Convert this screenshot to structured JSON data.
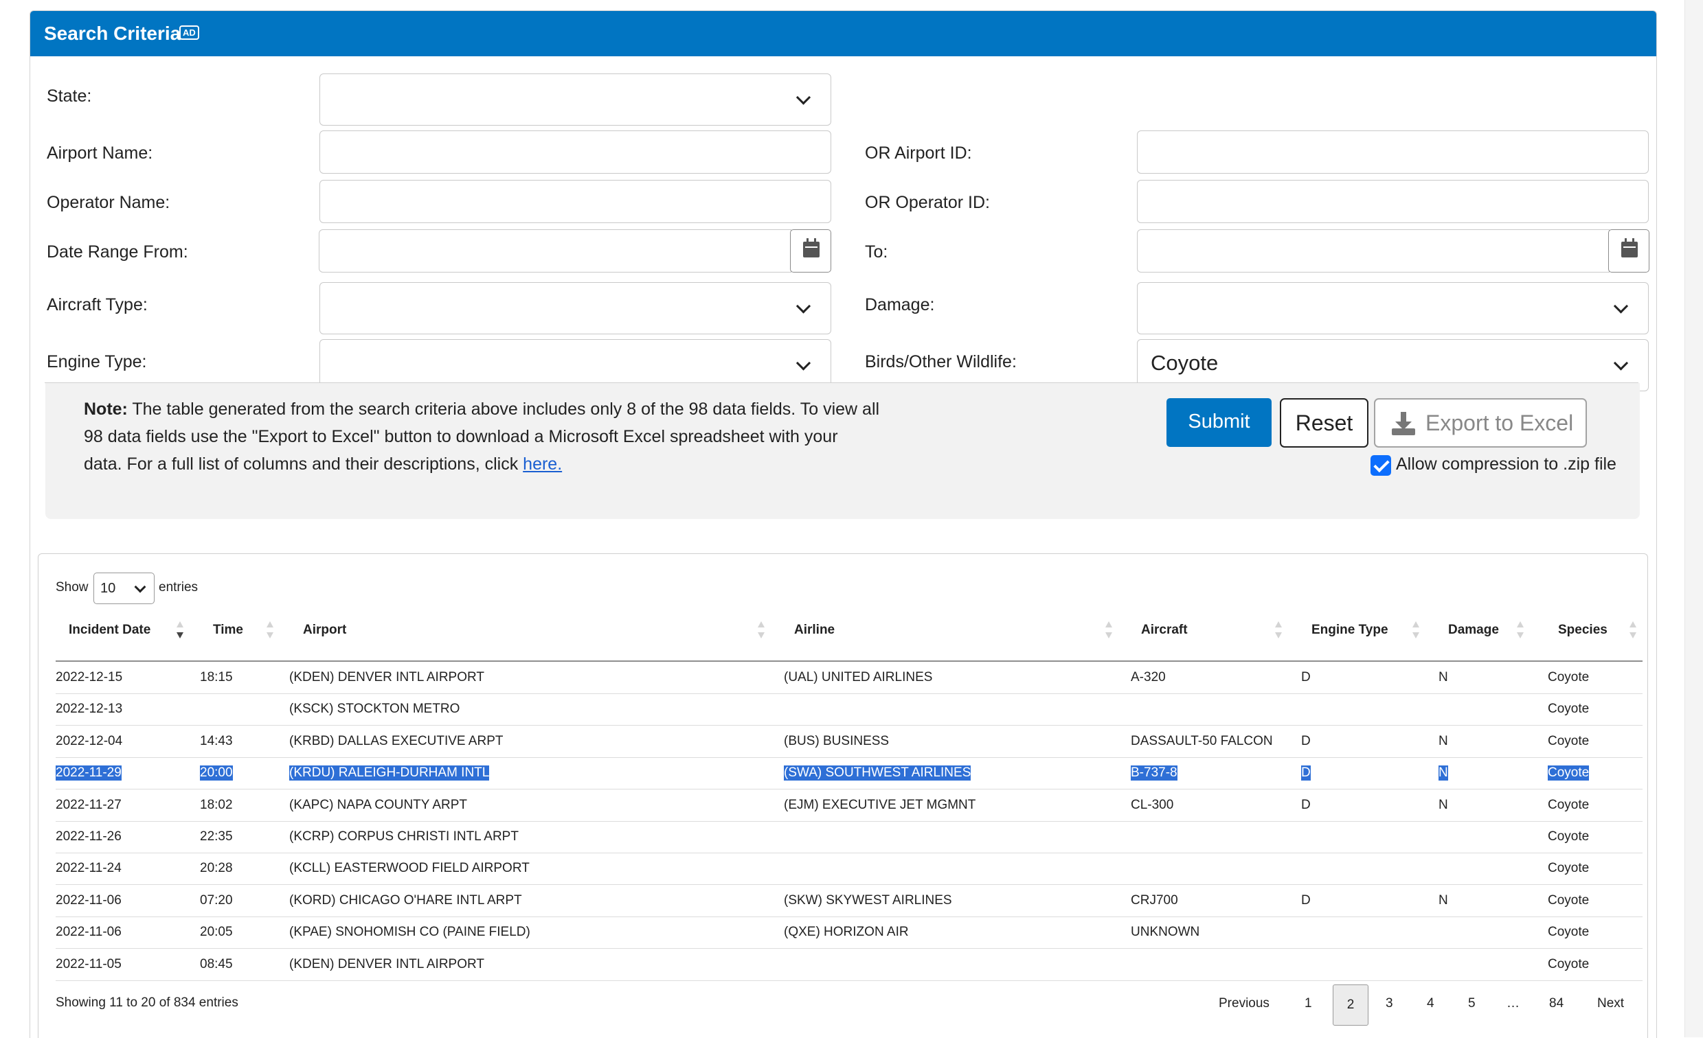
{
  "search": {
    "title": "Search Criteria",
    "badge": "AD",
    "labels": {
      "state": "State:",
      "airport_name": "Airport Name:",
      "airport_id": "OR Airport ID:",
      "operator_name": "Operator Name:",
      "operator_id": "OR Operator ID:",
      "date_from": "Date Range From:",
      "date_to": "To:",
      "aircraft_type": "Aircraft Type:",
      "damage": "Damage:",
      "engine_type": "Engine Type:",
      "wildlife": "Birds/Other Wildlife:"
    },
    "values": {
      "state": "",
      "airport_name": "",
      "airport_id": "",
      "operator_name": "",
      "operator_id": "",
      "date_from": "",
      "date_to": "",
      "aircraft_type": "",
      "damage": "",
      "engine_type": "",
      "wildlife": "Coyote"
    }
  },
  "note": {
    "bold": "Note:",
    "text": " The table generated from the search criteria above includes only 8 of the 98 data fields. To view all 98 data fields use the \"Export to Excel\" button to download a Microsoft Excel spreadsheet with your data. For a full list of columns and their descriptions, click ",
    "link": "here."
  },
  "buttons": {
    "submit": "Submit",
    "reset": "Reset",
    "export": "Export to Excel",
    "compress_label": "Allow compression to .zip file",
    "compress_checked": true
  },
  "table": {
    "show_label": "Show",
    "page_length": "10",
    "entries_label": "entries",
    "columns": [
      "Incident Date",
      "Time",
      "Airport",
      "Airline",
      "Aircraft",
      "Engine Type",
      "Damage",
      "Species"
    ],
    "rows": [
      [
        "2022-12-15",
        "18:15",
        "(KDEN) DENVER INTL AIRPORT",
        "(UAL) UNITED AIRLINES",
        "A-320",
        "D",
        "N",
        "Coyote"
      ],
      [
        "2022-12-13",
        "",
        "(KSCK) STOCKTON METRO",
        "",
        "",
        "",
        "",
        "Coyote"
      ],
      [
        "2022-12-04",
        "14:43",
        "(KRBD) DALLAS EXECUTIVE ARPT",
        "(BUS) BUSINESS",
        "DASSAULT-50 FALCON",
        "D",
        "N",
        "Coyote"
      ],
      [
        "2022-11-29",
        "20:00",
        "(KRDU) RALEIGH-DURHAM INTL",
        "(SWA) SOUTHWEST AIRLINES",
        "B-737-8",
        "D",
        "N",
        "Coyote"
      ],
      [
        "2022-11-27",
        "18:02",
        "(KAPC) NAPA COUNTY ARPT",
        "(EJM) EXECUTIVE JET MGMNT",
        "CL-300",
        "D",
        "N",
        "Coyote"
      ],
      [
        "2022-11-26",
        "22:35",
        "(KCRP) CORPUS CHRISTI INTL ARPT",
        "",
        "",
        "",
        "",
        "Coyote"
      ],
      [
        "2022-11-24",
        "20:28",
        "(KCLL) EASTERWOOD FIELD AIRPORT",
        "",
        "",
        "",
        "",
        "Coyote"
      ],
      [
        "2022-11-06",
        "07:20",
        "(KORD) CHICAGO O'HARE INTL ARPT",
        "(SKW) SKYWEST AIRLINES",
        "CRJ700",
        "D",
        "N",
        "Coyote"
      ],
      [
        "2022-11-06",
        "20:05",
        "(KPAE) SNOHOMISH CO (PAINE FIELD)",
        "(QXE) HORIZON AIR",
        "UNKNOWN",
        "",
        "",
        "Coyote"
      ],
      [
        "2022-11-05",
        "08:45",
        "(KDEN) DENVER INTL AIRPORT",
        "",
        "",
        "",
        "",
        "Coyote"
      ]
    ],
    "selected_row": 3,
    "info": "Showing 11 to 20 of 834 entries",
    "pagination": {
      "previous": "Previous",
      "pages": [
        "1",
        "2",
        "3",
        "4",
        "5",
        "…",
        "84"
      ],
      "current": "2",
      "next": "Next"
    }
  },
  "colors": {
    "header_blue": "#0175c2",
    "selection_blue": "#2e6fd6",
    "checkbox_blue": "#0d6efd"
  }
}
